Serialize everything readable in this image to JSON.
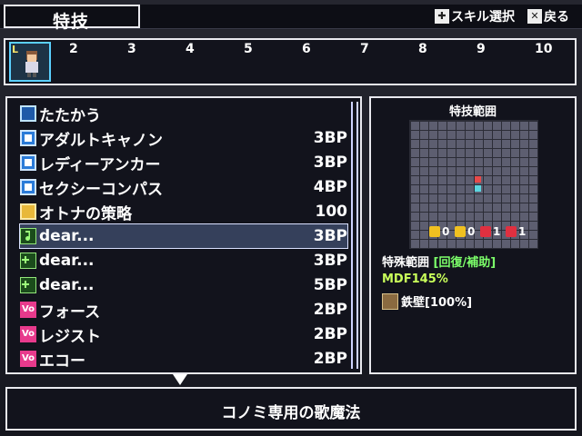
{
  "header": {
    "title": "特技",
    "hint_skill_select": "スキル選択",
    "hint_back": "戻る"
  },
  "party": {
    "leader_badge": "L",
    "slots": [
      "2",
      "3",
      "4",
      "5",
      "6",
      "7",
      "8",
      "9",
      "10"
    ]
  },
  "skill_list": [
    {
      "name": "たたかう",
      "cost": "",
      "icon": "sword-icon"
    },
    {
      "name": "アダルトキャノン",
      "cost": "3BP",
      "icon": "skill-icon"
    },
    {
      "name": "レディーアンカー",
      "cost": "3BP",
      "icon": "skill-icon"
    },
    {
      "name": "セクシーコンパス",
      "cost": "4BP",
      "icon": "skill-icon"
    },
    {
      "name": "オトナの策略",
      "cost": "100",
      "icon": "strategy-icon"
    },
    {
      "name": "dear...",
      "cost": "3BP",
      "icon": "music-note-icon"
    },
    {
      "name": "dear...",
      "cost": "3BP",
      "icon": "music-plus-icon"
    },
    {
      "name": "dear...",
      "cost": "5BP",
      "icon": "music-plus-icon"
    },
    {
      "name": "フォース",
      "cost": "2BP",
      "icon": "vo-icon"
    },
    {
      "name": "レジスト",
      "cost": "2BP",
      "icon": "vo-icon"
    },
    {
      "name": "エコー",
      "cost": "2BP",
      "icon": "vo-icon"
    }
  ],
  "selected_index": 5,
  "range_panel": {
    "title": "特技範囲",
    "buffs": [
      {
        "value": "0",
        "color": "#f0c020"
      },
      {
        "value": "0",
        "color": "#f0c020"
      },
      {
        "value": "1",
        "color": "#e03040"
      },
      {
        "value": "1",
        "color": "#e03040"
      }
    ],
    "special_label": "特殊範囲",
    "special_value": "[回復/補助]",
    "mdf_label": "MDF",
    "mdf_value": "145%",
    "status_name": "鉄壁[100%]"
  },
  "description": "コノミ専用の歌魔法"
}
